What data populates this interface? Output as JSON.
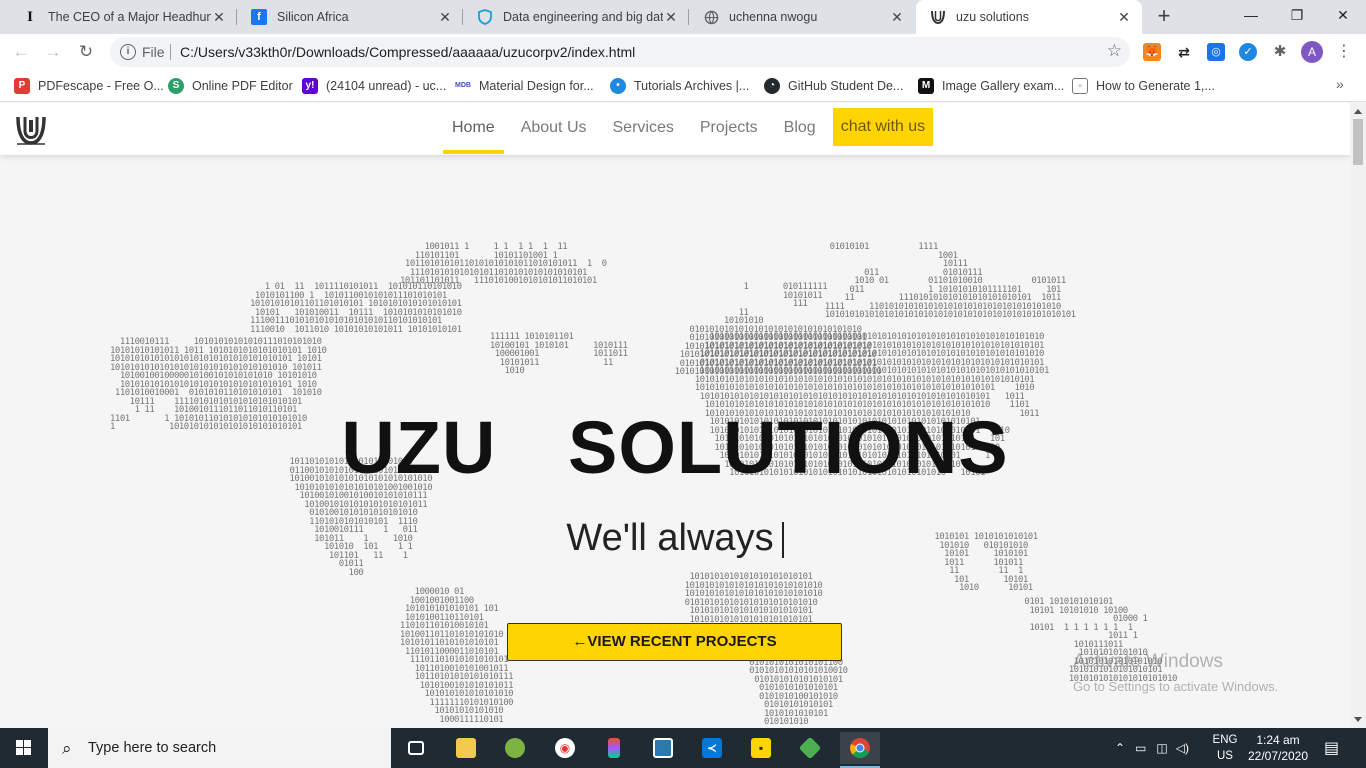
{
  "browser": {
    "tabs": [
      {
        "title": "The CEO of a Major Headhunti",
        "icon": "instapaper-icon"
      },
      {
        "title": "Silicon Africa",
        "icon": "facebook-icon"
      },
      {
        "title": "Data engineering and big data",
        "icon": "shield-icon"
      },
      {
        "title": "uchenna nwogu",
        "icon": "globe-icon"
      },
      {
        "title": "uzu solutions",
        "icon": "uzu-logo-icon"
      }
    ],
    "new_tab": "+",
    "window_controls": {
      "minimize": "—",
      "maximize": "❐",
      "close": "✕"
    },
    "address": {
      "scheme_label": "File",
      "url": "C:/Users/v33kth0r/Downloads/Compressed/aaaaaa/uzucorpv2/index.html"
    },
    "profile_initial": "A",
    "bookmarks": [
      {
        "label": "PDFescape - Free O...",
        "icon": "pdf-icon",
        "color": "#e53935"
      },
      {
        "label": "Online PDF Editor",
        "icon": "sejda-icon",
        "color": "#2e9e6b"
      },
      {
        "label": "(24104 unread) - uc...",
        "icon": "yahoo-icon",
        "color": "#6001d2"
      },
      {
        "label": "Material Design for...",
        "icon": "mdb-icon",
        "color": "#3f51b5"
      },
      {
        "label": "Tutorials Archives |...",
        "icon": "tutorials-icon",
        "color": "#1e88e5"
      },
      {
        "label": "GitHub Student De...",
        "icon": "github-icon",
        "color": "#24292e"
      },
      {
        "label": "Image Gallery exam...",
        "icon": "medium-icon",
        "color": "#111111"
      },
      {
        "label": "How to Generate 1,...",
        "icon": "page-icon",
        "color": "#777777"
      }
    ],
    "bookmarks_overflow": "»"
  },
  "site": {
    "nav": [
      {
        "label": "Home",
        "active": true
      },
      {
        "label": "About Us"
      },
      {
        "label": "Services"
      },
      {
        "label": "Projects"
      },
      {
        "label": "Blog"
      }
    ],
    "chat_label": "chat with us",
    "hero_title": "UZU SOLUTIONS",
    "hero_subtitle": "We'll always",
    "cta_label": "←VIEW RECENT PROJECTS",
    "accent_color": "#ffd400"
  },
  "watermark": {
    "line1": "Activate Windows",
    "line2": "Go to Settings to activate Windows."
  },
  "taskbar": {
    "search_placeholder": "Type here to search",
    "language": "ENG",
    "region": "US",
    "time": "1:24 am",
    "date": "22/07/2020"
  }
}
